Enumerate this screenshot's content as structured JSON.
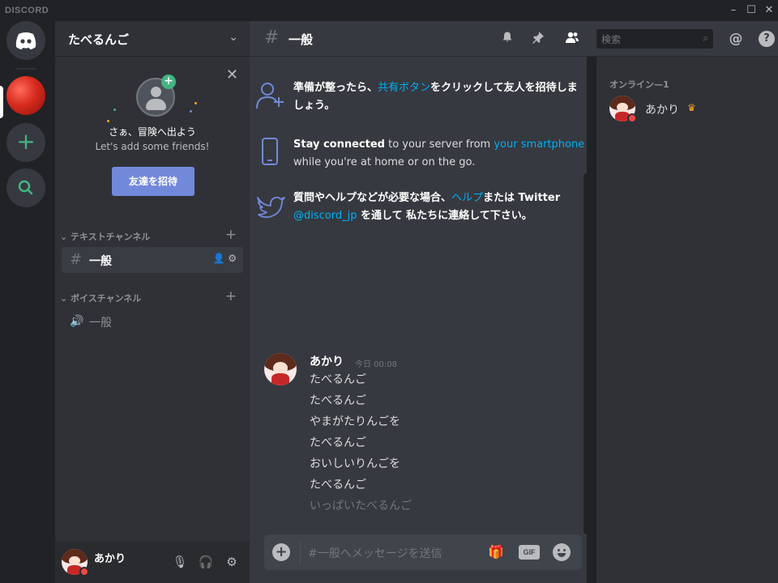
{
  "titlebar": {
    "brand": "DISCORD",
    "minimize": "–",
    "maximize": "☐",
    "close": "✕"
  },
  "guild": {
    "name": "たべるんご",
    "chevron": "⌄"
  },
  "invite": {
    "close": "✕",
    "title": "さぁ、冒険へ出よう",
    "subtitle": "Let's add some friends!",
    "button": "友達を招待"
  },
  "categories": {
    "text": "⌄ テキストチャンネル",
    "voice": "⌄ ボイスチャンネル",
    "add": "+"
  },
  "channels": {
    "text": [
      {
        "icon": "#",
        "name": "一般"
      }
    ],
    "voice": [
      {
        "icon": "🔊",
        "name": "一般"
      }
    ]
  },
  "user": {
    "name": "あかり",
    "mic": "🎙",
    "headset": "🎧",
    "settings": "⚙"
  },
  "header": {
    "hash": "#",
    "title": "一般",
    "search_placeholder": "検索",
    "search_icon": "⌕",
    "mention": "@",
    "help": "?"
  },
  "tips": {
    "t1": {
      "a": "準備が整ったら、",
      "link": "共有ボタン",
      "b": "をクリックして",
      "bold": "友人を招待",
      "c": "しましょう。"
    },
    "t2": {
      "bold": "Stay connected",
      "a": " to your server from ",
      "link": "your smartphone",
      "b": " while you're at home or on the go."
    },
    "t3": {
      "a": "質問やヘルプなどが必要な場合、",
      "link1": "ヘルプ",
      "b": "または Twitter ",
      "link2": "@discord_jp",
      "c": " を通して ",
      "bold": "私たちに連絡",
      "d": "して下さい。"
    }
  },
  "message": {
    "author": "あかり",
    "time": "今日 00:08",
    "lines": [
      "たべるんご",
      "たべるんご",
      "やまがたりんごを",
      "たべるんご",
      "おいしいりんごを",
      "たべるんご"
    ],
    "pending": "いっぱいたべるんご"
  },
  "composer": {
    "placeholder": "#一般へメッセージを送信",
    "plus": "+",
    "gift": "🎁",
    "gif": "GIF"
  },
  "members": {
    "category": "オンライン—1",
    "list": [
      {
        "name": "あかり",
        "badge": "♛"
      }
    ]
  },
  "colors": {
    "accent": "#7289da",
    "link": "#00b0f4",
    "online": "#43b581",
    "dnd": "#f04747",
    "owner": "#faa61a"
  }
}
